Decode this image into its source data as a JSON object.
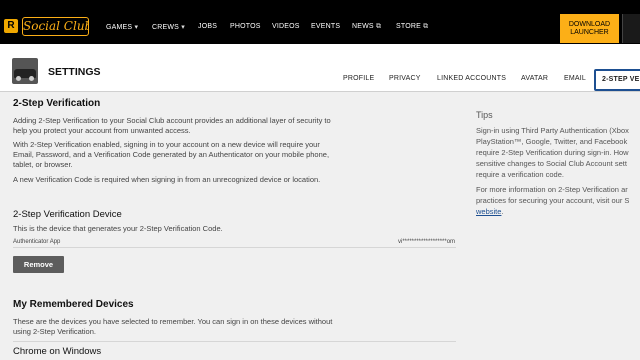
{
  "nav": {
    "logo_letter": "R",
    "logo_text": "Social Club",
    "items": [
      {
        "label": "GAMES",
        "suffix": "▾"
      },
      {
        "label": "CREWS",
        "suffix": "▾"
      },
      {
        "label": "JOBS",
        "suffix": ""
      },
      {
        "label": "PHOTOS",
        "suffix": ""
      },
      {
        "label": "VIDEOS",
        "suffix": ""
      },
      {
        "label": "EVENTS",
        "suffix": ""
      },
      {
        "label": "NEWS",
        "suffix": "⧉"
      },
      {
        "label": "STORE",
        "suffix": "⧉"
      }
    ],
    "download_line1": "DOWNLOAD",
    "download_line2": "LAUNCHER"
  },
  "header": {
    "title": "SETTINGS",
    "tabs": [
      "PROFILE",
      "PRIVACY",
      "LINKED ACCOUNTS",
      "AVATAR",
      "EMAIL"
    ],
    "active_tab": "2-STEP VE"
  },
  "main": {
    "section1_title": "2-Step Verification",
    "para1_line1": "Adding 2-Step Verification to your Social Club account provides an additional layer of security to",
    "para1_line2": "help you protect your account from unwanted access.",
    "para2_line1": "With 2-Step Verification enabled, signing in to your account on a new device will require your",
    "para2_line2": "Email, Password, and a Verification Code generated by an Authenticator on your mobile phone,",
    "para2_line3": "tablet, or browser.",
    "para3": "A new Verification Code is required when signing in from an unrecognized device or location.",
    "device_title": "2-Step Verification Device",
    "device_desc": "This is the device that generates your 2-Step Verification Code.",
    "authenticator_label": "Authenticator App",
    "masked_email": "vi*******************om",
    "remove_label": "Remove",
    "remembered_title": "My Remembered Devices",
    "remembered_line1": "These are the devices you have selected to remember. You can sign in on these devices without",
    "remembered_line2": "using 2-Step Verification.",
    "device_name": "Chrome on Windows"
  },
  "tips": {
    "title": "Tips",
    "line1": "Sign-in using Third Party Authentication (Xbox",
    "line2": "PlayStation™, Google, Twitter, and Facebook",
    "line3": "require 2-Step Verification during sign-in. How",
    "line4": "sensitive changes to Social Club Account sett",
    "line5": "require a verification code.",
    "line6": "For more information on 2-Step Verification ar",
    "line7": "practices for securing your account, visit our S",
    "link": "website",
    "link_suffix": "."
  },
  "colors": {
    "nav_bg": "#000000",
    "accent": "#fcaf17",
    "active_tab_border": "#1d4f91",
    "button_bg": "#5d5d5d",
    "page_bg": "#f0f0f0"
  }
}
